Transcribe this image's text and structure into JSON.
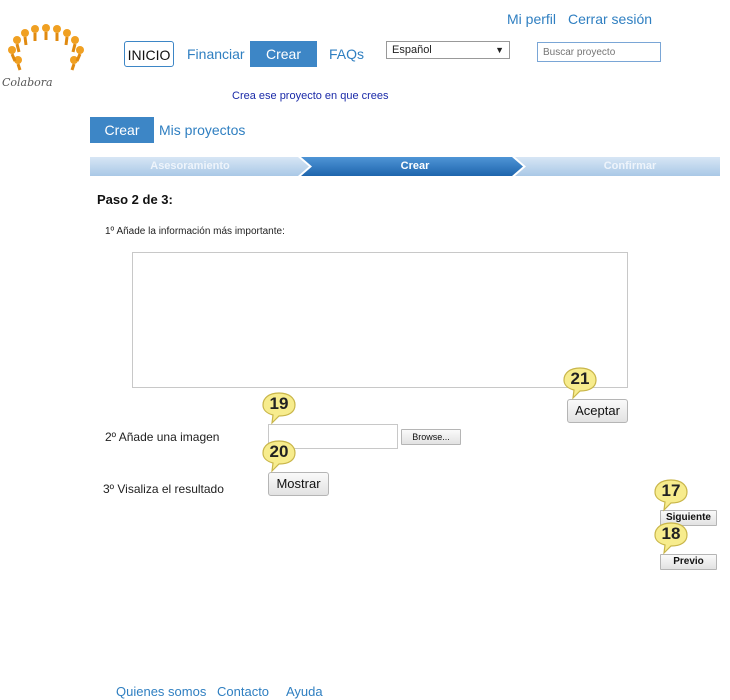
{
  "logo": {
    "text": "Colabora"
  },
  "header": {
    "profile_link": "Mi perfil",
    "logout_link": "Cerrar sesión",
    "nav": {
      "inicio": "INICIO",
      "financiar": "Financiar",
      "crear": "Crear",
      "faqs": "FAQs"
    },
    "language": "Español",
    "search_placeholder": "Buscar proyecto",
    "tagline": "Crea ese proyecto en que crees"
  },
  "subnav": {
    "crear": "Crear",
    "mis_proyectos": "Mis proyectos"
  },
  "steps": [
    "Asesoramiento",
    "Crear",
    "Confirmar"
  ],
  "main": {
    "step_title": "Paso 2 de 3:",
    "info_label": "1º Añade la información más importante:",
    "aceptar": "Aceptar",
    "image_label": "2º Añade una imagen",
    "browse": "Browse...",
    "visualize_label": "3º Visaliza el resultado",
    "mostrar": "Mostrar",
    "siguiente": "Siguiente",
    "previo": "Previo"
  },
  "badges": {
    "b21": "21",
    "b19": "19",
    "b20": "20",
    "b17": "17",
    "b18": "18"
  },
  "footer": {
    "quienes": "Quienes somos",
    "contacto": "Contacto",
    "ayuda": "Ayuda"
  },
  "colors": {
    "accent": "#3d86c6",
    "link": "#2f7fc1",
    "badge": "#f7ec8d"
  }
}
